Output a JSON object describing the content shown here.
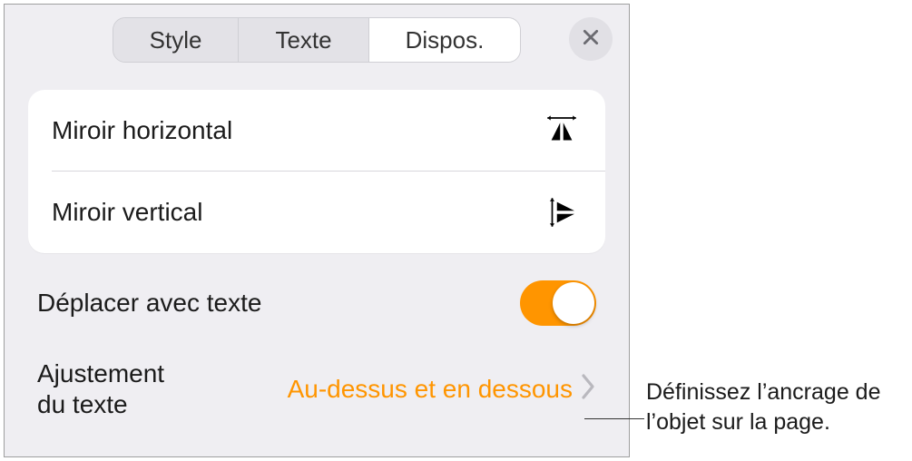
{
  "tabs": {
    "style": "Style",
    "text": "Texte",
    "dispos": "Dispos."
  },
  "mirror": {
    "horizontal": "Miroir horizontal",
    "vertical": "Miroir vertical"
  },
  "moveWithText": {
    "label": "Déplacer avec texte",
    "on": true
  },
  "textWrap": {
    "label": "Ajustement\ndu texte",
    "value": "Au-dessus et en dessous"
  },
  "callout": "Définissez l’ancrage de l’objet sur la page.",
  "colors": {
    "accent": "#ff9500"
  }
}
